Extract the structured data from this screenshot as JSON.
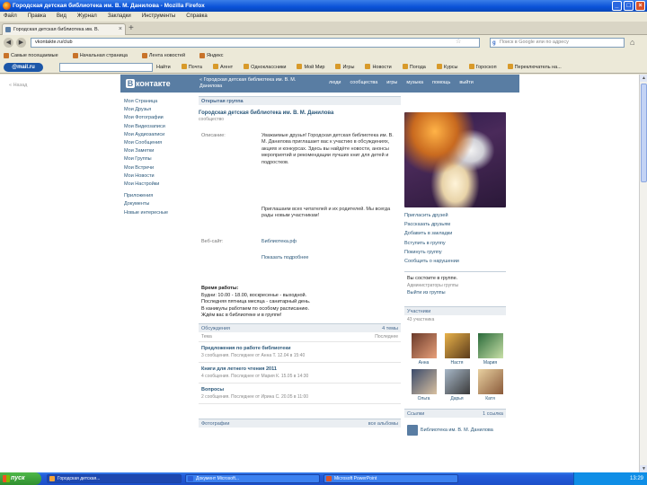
{
  "window": {
    "title": "Городская детская библиотека им. В. М. Данилова - Mozilla Firefox",
    "buttons": [
      "_",
      "□",
      "×"
    ]
  },
  "menu": [
    "Файл",
    "Правка",
    "Вид",
    "Журнал",
    "Закладки",
    "Инструменты",
    "Справка"
  ],
  "tab": {
    "label": "Городская детская библиотека им. В.",
    "close": "×",
    "new": "+"
  },
  "nav": {
    "back": "◀",
    "forward": "▶",
    "url": "vkontakte.ru/club",
    "search_placeholder": "Поиск в Google или по адресу",
    "home": "⌂"
  },
  "bookmarks": [
    "Самые посещаемые",
    "Начальная страница",
    "Лента новостей",
    "Яндекс"
  ],
  "mailbar": {
    "logo": "@mail.ru",
    "search_value": "Найти",
    "items": [
      "Почта",
      "Агент",
      "Одноклассники",
      "Мой Мир",
      "Игры",
      "Новости",
      "Погода",
      "Курсы",
      "Гороскоп",
      "Переключатель на..."
    ]
  },
  "page": {
    "back_link": "« Назад"
  },
  "vk": {
    "logo": "контакте",
    "logo_letter": "В",
    "group_header": "« Городская детская библиотека им. В. М. Данилова",
    "nav": [
      "люди",
      "сообщества",
      "игры",
      "музыка",
      "помощь",
      "выйти"
    ],
    "left_menu": [
      "Моя Страница",
      "Мои Друзья",
      "Мои Фотографии",
      "Мои Видеозаписи",
      "Мои Аудиозаписи",
      "Мои Сообщения",
      "Мои Заметки",
      "Мои Группы",
      "Мои Встречи",
      "Мои Новости",
      "Мои Настройки",
      "Приложения",
      "Документы",
      "Новые интересные"
    ],
    "open_group": "Открытая группа",
    "group_title": "Городская детская библиотека им. В. М. Данилова",
    "group_sub": "сообщество",
    "info_label_1": "Описание:",
    "info_text_1": "Уважаемые друзья! Городская детская библиотека им. В. М. Данилова приглашает вас к участию в обсуждениях, акциях и конкурсах. Здесь вы найдёте новости, анонсы мероприятий и рекомендации лучших книг для детей и подростков.",
    "info_text_2": "Приглашаем всех читателей и их родителей. Мы всегда рады новым участникам!",
    "info_label_2": "Веб-сайт:",
    "info_link": "Библиотека.рф",
    "info_link_2": "Показать подробнее",
    "meeting_title": "Время работы:",
    "meeting_lines": [
      "Будни: 10.00 - 18.00, воскресенье - выходной.",
      "Последняя пятница месяца - санитарный день.",
      "В каникулы работаем по особому расписанию.",
      "Ждём вас в библиотеке и в группе!"
    ],
    "discussions_title": "Обсуждения",
    "discussions_all": "4 темы",
    "discussions_cols": [
      "Тема",
      "Последнее"
    ],
    "topics": [
      {
        "title": "Предложения по работе библиотеки",
        "meta": "3 сообщения. Последнее от Анна Т. 12.04 в 15:40"
      },
      {
        "title": "Книги для летнего чтения 2011",
        "meta": "4 сообщения. Последнее от Мария К. 15.05 в 14:30"
      },
      {
        "title": "Вопросы",
        "meta": "2 сообщения. Последнее от Ирина С. 20.05 в 11:00"
      }
    ],
    "photos_title": "Фотографии",
    "photos_all": "все альбомы",
    "actions": [
      "Пригласить друзей",
      "Рассказать друзьям",
      "Добавить в закладки",
      "Вступить в группу",
      "Покинуть группу",
      "Сообщить о нарушении"
    ],
    "member_box_title": "Вы состоите в группе.",
    "member_box_sub": "Администраторы группы",
    "member_box_link": "Выйти из группы",
    "members_title": "Участники",
    "members_count": "43 участника",
    "members": [
      "Анна",
      "Настя",
      "Мария",
      "Ольга",
      "Дарья",
      "Катя"
    ],
    "links_title": "Ссылки",
    "links_count": "1 ссылка",
    "link_name": "Библиотека им. В. М. Данилова"
  },
  "taskbar": {
    "start": "пуск",
    "buttons": [
      "Городская детская...",
      "Документ Microsoft...",
      "Microsoft PowerPoint"
    ],
    "clock": "13:29"
  },
  "colors": {
    "vk_header": "#597da3",
    "vk_link": "#2b587a",
    "xp_titlebar": "#0a52d8"
  }
}
